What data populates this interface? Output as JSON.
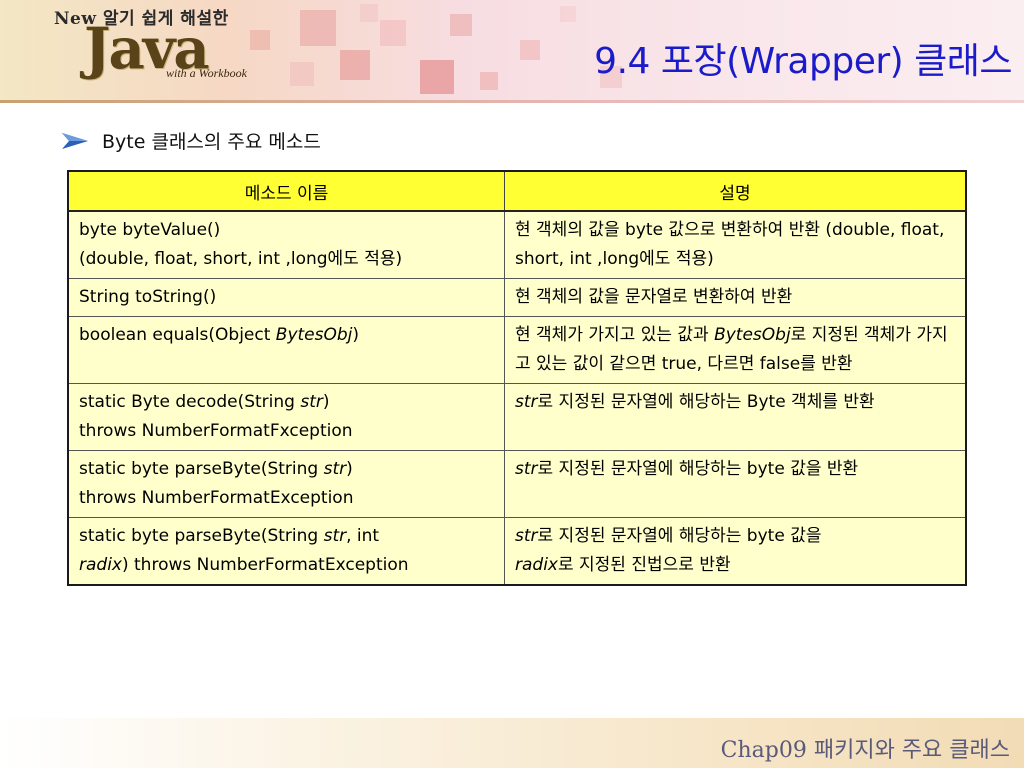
{
  "header": {
    "logo_top": "New 알기 쉽게 해설한",
    "logo_main": "Java",
    "logo_sub": "with a Workbook",
    "title": "9.4 포장(Wrapper) 클래스"
  },
  "section": {
    "title": "Byte 클래스의 주요 메소드"
  },
  "table": {
    "headers": [
      "메소드 이름",
      "설명"
    ],
    "rows": [
      {
        "method": [
          "byte byteValue()",
          "(double, float, short, int ,long에도 적용)"
        ],
        "desc": "현 객체의 값을 byte 값으로 변환하여 반환 (double, float, short, int ,long에도 적용)"
      },
      {
        "method": [
          "String toString()"
        ],
        "desc": "현 객체의 값을 문자열로 변환하여 반환"
      },
      {
        "method_pre": "boolean equals(Object ",
        "method_em": "BytesObj",
        "method_post": ")",
        "desc_pre": "현 객체가 가지고 있는 값과 ",
        "desc_em": "BytesObj",
        "desc_post": "로 지정된 객체가 가지고 있는 값이 같으면 true, 다르면 false를 반환"
      },
      {
        "method_pre": "static Byte decode(String ",
        "method_em": "str",
        "method_post": ")",
        "method_line2": "throws NumberFormatFxception",
        "desc_em": "str",
        "desc_post": "로 지정된 문자열에 해당하는 Byte 객체를 반환"
      },
      {
        "method_pre": "static byte parseByte(String ",
        "method_em": "str",
        "method_post": ")",
        "method_line2": "throws NumberFormatException",
        "desc_em": "str",
        "desc_post": "로 지정된 문자열에 해당하는 byte 값을 반환"
      },
      {
        "method_pre": "static byte parseByte(String ",
        "method_em": "str",
        "method_mid": ", int",
        "method_em2": "radix",
        "method_post": ") throws NumberFormatException",
        "desc_em": "str",
        "desc_post": "로 지정된 문자열에 해당하는 byte 값을",
        "desc_em2": "radix",
        "desc_post2": "로 지정된 진법으로 반환"
      }
    ]
  },
  "footer": {
    "text": "Chap09 패키지와 주요 클래스"
  },
  "colors": {
    "title": "#1b1bc9",
    "table_header_bg": "#ffff33",
    "table_body_bg": "#ffffcc",
    "bullet": "#2b5fb8"
  }
}
